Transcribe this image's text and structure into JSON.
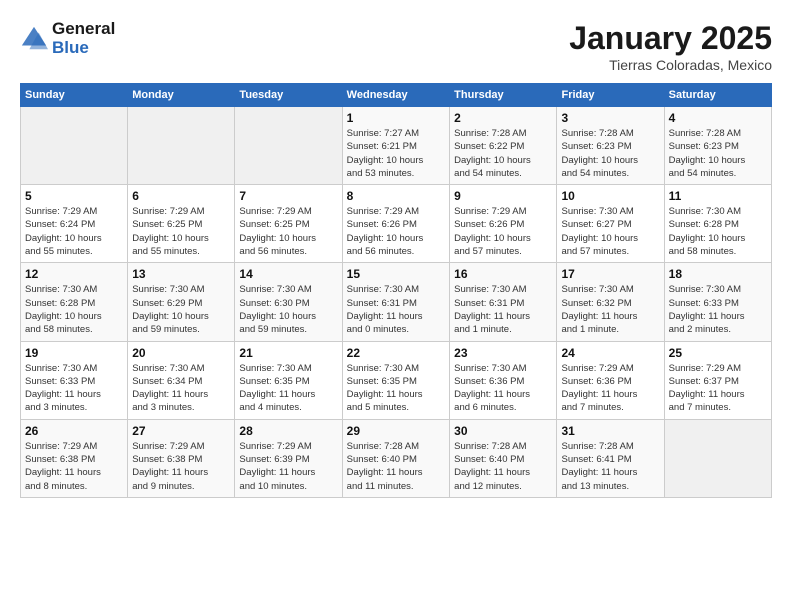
{
  "header": {
    "logo_line1": "General",
    "logo_line2": "Blue",
    "month": "January 2025",
    "location": "Tierras Coloradas, Mexico"
  },
  "weekdays": [
    "Sunday",
    "Monday",
    "Tuesday",
    "Wednesday",
    "Thursday",
    "Friday",
    "Saturday"
  ],
  "weeks": [
    [
      {
        "day": "",
        "info": ""
      },
      {
        "day": "",
        "info": ""
      },
      {
        "day": "",
        "info": ""
      },
      {
        "day": "1",
        "info": "Sunrise: 7:27 AM\nSunset: 6:21 PM\nDaylight: 10 hours\nand 53 minutes."
      },
      {
        "day": "2",
        "info": "Sunrise: 7:28 AM\nSunset: 6:22 PM\nDaylight: 10 hours\nand 54 minutes."
      },
      {
        "day": "3",
        "info": "Sunrise: 7:28 AM\nSunset: 6:23 PM\nDaylight: 10 hours\nand 54 minutes."
      },
      {
        "day": "4",
        "info": "Sunrise: 7:28 AM\nSunset: 6:23 PM\nDaylight: 10 hours\nand 54 minutes."
      }
    ],
    [
      {
        "day": "5",
        "info": "Sunrise: 7:29 AM\nSunset: 6:24 PM\nDaylight: 10 hours\nand 55 minutes."
      },
      {
        "day": "6",
        "info": "Sunrise: 7:29 AM\nSunset: 6:25 PM\nDaylight: 10 hours\nand 55 minutes."
      },
      {
        "day": "7",
        "info": "Sunrise: 7:29 AM\nSunset: 6:25 PM\nDaylight: 10 hours\nand 56 minutes."
      },
      {
        "day": "8",
        "info": "Sunrise: 7:29 AM\nSunset: 6:26 PM\nDaylight: 10 hours\nand 56 minutes."
      },
      {
        "day": "9",
        "info": "Sunrise: 7:29 AM\nSunset: 6:26 PM\nDaylight: 10 hours\nand 57 minutes."
      },
      {
        "day": "10",
        "info": "Sunrise: 7:30 AM\nSunset: 6:27 PM\nDaylight: 10 hours\nand 57 minutes."
      },
      {
        "day": "11",
        "info": "Sunrise: 7:30 AM\nSunset: 6:28 PM\nDaylight: 10 hours\nand 58 minutes."
      }
    ],
    [
      {
        "day": "12",
        "info": "Sunrise: 7:30 AM\nSunset: 6:28 PM\nDaylight: 10 hours\nand 58 minutes."
      },
      {
        "day": "13",
        "info": "Sunrise: 7:30 AM\nSunset: 6:29 PM\nDaylight: 10 hours\nand 59 minutes."
      },
      {
        "day": "14",
        "info": "Sunrise: 7:30 AM\nSunset: 6:30 PM\nDaylight: 10 hours\nand 59 minutes."
      },
      {
        "day": "15",
        "info": "Sunrise: 7:30 AM\nSunset: 6:31 PM\nDaylight: 11 hours\nand 0 minutes."
      },
      {
        "day": "16",
        "info": "Sunrise: 7:30 AM\nSunset: 6:31 PM\nDaylight: 11 hours\nand 1 minute."
      },
      {
        "day": "17",
        "info": "Sunrise: 7:30 AM\nSunset: 6:32 PM\nDaylight: 11 hours\nand 1 minute."
      },
      {
        "day": "18",
        "info": "Sunrise: 7:30 AM\nSunset: 6:33 PM\nDaylight: 11 hours\nand 2 minutes."
      }
    ],
    [
      {
        "day": "19",
        "info": "Sunrise: 7:30 AM\nSunset: 6:33 PM\nDaylight: 11 hours\nand 3 minutes."
      },
      {
        "day": "20",
        "info": "Sunrise: 7:30 AM\nSunset: 6:34 PM\nDaylight: 11 hours\nand 3 minutes."
      },
      {
        "day": "21",
        "info": "Sunrise: 7:30 AM\nSunset: 6:35 PM\nDaylight: 11 hours\nand 4 minutes."
      },
      {
        "day": "22",
        "info": "Sunrise: 7:30 AM\nSunset: 6:35 PM\nDaylight: 11 hours\nand 5 minutes."
      },
      {
        "day": "23",
        "info": "Sunrise: 7:30 AM\nSunset: 6:36 PM\nDaylight: 11 hours\nand 6 minutes."
      },
      {
        "day": "24",
        "info": "Sunrise: 7:29 AM\nSunset: 6:36 PM\nDaylight: 11 hours\nand 7 minutes."
      },
      {
        "day": "25",
        "info": "Sunrise: 7:29 AM\nSunset: 6:37 PM\nDaylight: 11 hours\nand 7 minutes."
      }
    ],
    [
      {
        "day": "26",
        "info": "Sunrise: 7:29 AM\nSunset: 6:38 PM\nDaylight: 11 hours\nand 8 minutes."
      },
      {
        "day": "27",
        "info": "Sunrise: 7:29 AM\nSunset: 6:38 PM\nDaylight: 11 hours\nand 9 minutes."
      },
      {
        "day": "28",
        "info": "Sunrise: 7:29 AM\nSunset: 6:39 PM\nDaylight: 11 hours\nand 10 minutes."
      },
      {
        "day": "29",
        "info": "Sunrise: 7:28 AM\nSunset: 6:40 PM\nDaylight: 11 hours\nand 11 minutes."
      },
      {
        "day": "30",
        "info": "Sunrise: 7:28 AM\nSunset: 6:40 PM\nDaylight: 11 hours\nand 12 minutes."
      },
      {
        "day": "31",
        "info": "Sunrise: 7:28 AM\nSunset: 6:41 PM\nDaylight: 11 hours\nand 13 minutes."
      },
      {
        "day": "",
        "info": ""
      }
    ]
  ]
}
